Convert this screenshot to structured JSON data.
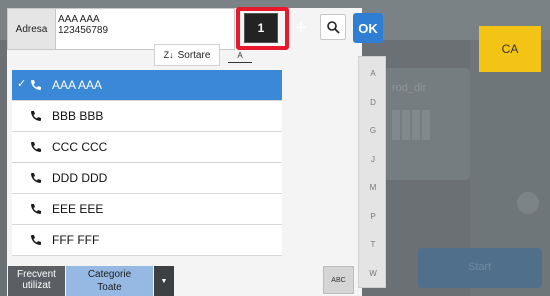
{
  "background": {
    "card_label": "rod_dir",
    "start_label": "Start"
  },
  "ca_label": "CA",
  "address": {
    "label": "Adresa",
    "line1": "AAA AAA",
    "line2": "123456789"
  },
  "number_value": "1",
  "ok_label": "OK",
  "sort": {
    "label": "Sortare",
    "az_icon_text": "A"
  },
  "contacts": [
    {
      "name": "AAA AAA",
      "selected": true
    },
    {
      "name": "BBB BBB",
      "selected": false
    },
    {
      "name": "CCC CCC",
      "selected": false
    },
    {
      "name": "DDD DDD",
      "selected": false
    },
    {
      "name": "EEE EEE",
      "selected": false
    },
    {
      "name": "FFF FFF",
      "selected": false
    }
  ],
  "index_letters": [
    "A",
    "D",
    "G",
    "J",
    "M",
    "P",
    "T",
    "W"
  ],
  "bottom": {
    "frequent_line1": "Frecvent",
    "frequent_line2": "utilizat",
    "category_line1": "Categorie",
    "category_line2": "Toate",
    "abc_label": "ABC"
  },
  "colors": {
    "accent_blue": "#3b87d8",
    "ok_blue": "#2e7fd4",
    "highlight_red": "#e8192c",
    "ca_yellow": "#f3c316"
  }
}
